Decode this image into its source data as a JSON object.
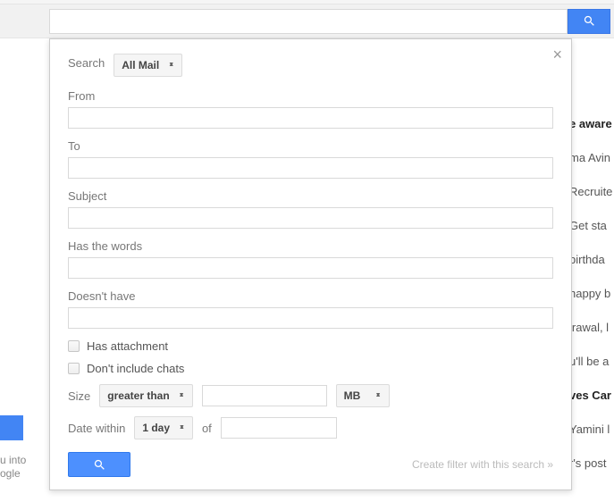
{
  "topbar": {
    "search_value": ""
  },
  "panel": {
    "close": "×",
    "search_label": "Search",
    "scope_value": "All Mail",
    "from_label": "From",
    "to_label": "To",
    "subject_label": "Subject",
    "haswords_label": "Has the words",
    "doesnthave_label": "Doesn't have",
    "has_attachment_label": "Has attachment",
    "dont_include_chats_label": "Don't include chats",
    "size_label": "Size",
    "size_operator": "greater than",
    "size_value": "",
    "size_unit": "MB",
    "date_label": "Date within",
    "date_range": "1 day",
    "date_of": "of",
    "date_value": "",
    "filter_link": "Create filter with this search »"
  },
  "bg": {
    "r1": "e aware",
    "r2": "ma Avin",
    "r3": "Recruite",
    "r4": "Get sta",
    "r5": "birthda",
    "r6": "happy b",
    "r7": "lrawal, l",
    "r8": "u'll be a",
    "r9": "ves Car",
    "r10": "Yamini l",
    "r11": "r's post"
  },
  "left": {
    "l1": "u into",
    "l2": "ogle"
  }
}
